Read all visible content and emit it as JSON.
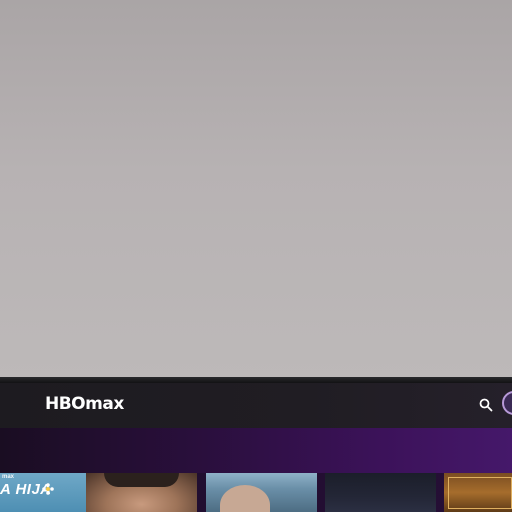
{
  "app": {
    "logo_text": "HBOmax"
  },
  "header": {
    "search_icon": "search-icon",
    "avatar_icon": "profile-avatar"
  },
  "row": {
    "tiles": [
      {
        "label": "A HIJA",
        "brand": "max"
      },
      {
        "label": ""
      },
      {
        "label": ""
      },
      {
        "label": ""
      },
      {
        "label": ""
      }
    ]
  },
  "colors": {
    "accent": "#8a3fc4",
    "topbar": "#1f1c22",
    "wall": "#b3aeae"
  }
}
